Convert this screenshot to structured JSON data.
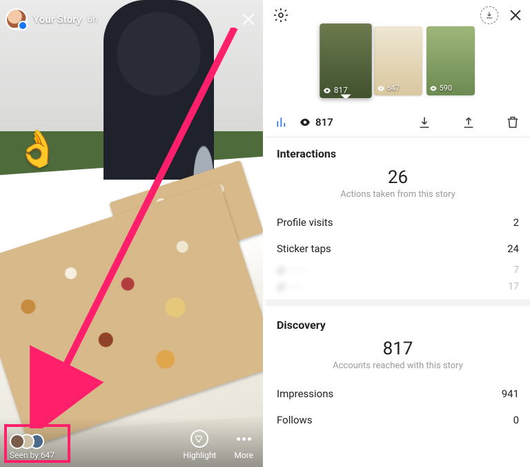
{
  "left": {
    "title": "Your Story",
    "time": "6h",
    "emoji": "👌",
    "seen_by_label": "Seen by 647",
    "highlight_label": "Highlight",
    "more_label": "More"
  },
  "right": {
    "thumbs": [
      {
        "views": "817",
        "selected": true
      },
      {
        "views": "647",
        "selected": false
      },
      {
        "views": "590",
        "selected": false
      }
    ],
    "toolbar_views": "817",
    "interactions": {
      "title": "Interactions",
      "count": "26",
      "subtitle": "Actions taken from this story",
      "rows": [
        {
          "label": "Profile visits",
          "value": "2"
        },
        {
          "label": "Sticker taps",
          "value": "24"
        }
      ],
      "sticker_sub": [
        {
          "label": "@·········",
          "value": "7"
        },
        {
          "label": "@······",
          "value": "17"
        }
      ]
    },
    "discovery": {
      "title": "Discovery",
      "count": "817",
      "subtitle": "Accounts reached with this story",
      "rows": [
        {
          "label": "Impressions",
          "value": "941"
        },
        {
          "label": "Follows",
          "value": "0"
        }
      ]
    }
  },
  "colors": {
    "accent": "#ff1f6b",
    "link": "#2d6ff0"
  }
}
